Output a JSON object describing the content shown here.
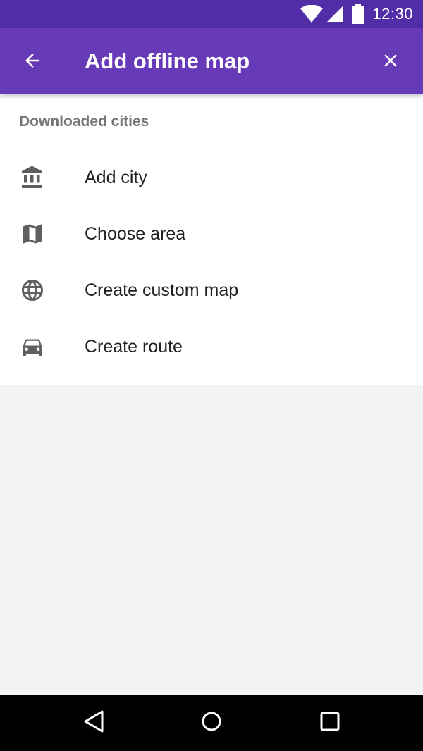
{
  "status_bar": {
    "time": "12:30",
    "icons": [
      "wifi-icon",
      "cell-signal-icon",
      "battery-icon"
    ],
    "color": "#512da8"
  },
  "app_bar": {
    "title": "Add offline map",
    "back_icon": "arrow-back-icon",
    "close_icon": "close-icon",
    "color": "#673ab7"
  },
  "section": {
    "header": "Downloaded cities"
  },
  "menu": {
    "items": [
      {
        "label": "Add city",
        "icon": "city-bank-icon"
      },
      {
        "label": "Choose area",
        "icon": "map-icon"
      },
      {
        "label": "Create custom map",
        "icon": "globe-icon"
      },
      {
        "label": "Create route",
        "icon": "car-icon"
      }
    ]
  },
  "nav_bar": {
    "icons": [
      "back-triangle-icon",
      "home-circle-icon",
      "recents-square-icon"
    ]
  }
}
